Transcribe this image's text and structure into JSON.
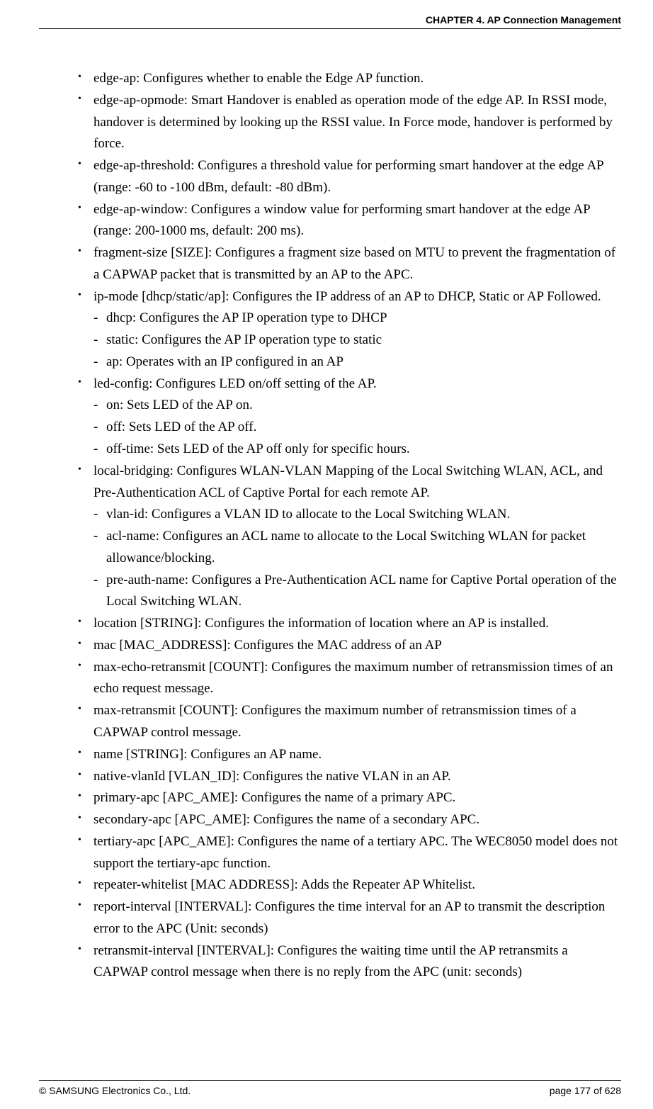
{
  "header": {
    "chapter": "CHAPTER 4. AP Connection Management"
  },
  "items": [
    {
      "text": "edge-ap: Configures whether to enable the Edge AP function."
    },
    {
      "text": "edge-ap-opmode: Smart Handover is enabled as operation mode of the edge AP. In RSSI mode, handover is determined by looking up the RSSI value. In Force mode, handover is performed by force."
    },
    {
      "text": "edge-ap-threshold: Configures a threshold value for performing smart handover at the edge AP (range: -60 to -100 dBm, default: -80 dBm)."
    },
    {
      "text": "edge-ap-window: Configures a window value for performing smart handover at the edge AP (range: 200-1000 ms, default: 200 ms)."
    },
    {
      "text": "fragment-size [SIZE]: Configures a fragment size based on MTU to prevent the fragmentation of a CAPWAP packet that is transmitted by an AP to the APC."
    },
    {
      "text": "ip-mode [dhcp/static/ap]: Configures the IP address of an AP to DHCP, Static or AP Followed.",
      "subs": [
        "dhcp: Configures the AP IP operation type to DHCP",
        "static: Configures the AP IP operation type to static",
        "ap: Operates with an IP configured in an AP"
      ]
    },
    {
      "text": "led-config: Configures LED on/off setting of the AP.",
      "subs": [
        "on: Sets LED of the AP on.",
        "off: Sets LED of the AP off.",
        "off-time: Sets LED of the AP off only for specific hours."
      ]
    },
    {
      "text": "local-bridging: Configures WLAN-VLAN Mapping of the Local Switching WLAN, ACL, and Pre-Authentication ACL of Captive Portal for each remote AP.",
      "subs": [
        "vlan-id: Configures a VLAN ID to allocate to the Local Switching WLAN.",
        "acl-name: Configures an ACL name to allocate to the Local Switching WLAN for packet allowance/blocking.",
        "pre-auth-name: Configures a Pre-Authentication ACL name for Captive Portal operation of the Local Switching WLAN."
      ]
    },
    {
      "text": "location [STRING]: Configures the information of location where an AP is installed."
    },
    {
      "text": "mac [MAC_ADDRESS]: Configures the MAC address of an AP"
    },
    {
      "text": "max-echo-retransmit [COUNT]: Configures the maximum number of retransmission times of an echo request message."
    },
    {
      "text": "max-retransmit [COUNT]: Configures the maximum number of retransmission times of a CAPWAP control message."
    },
    {
      "text": "name [STRING]: Configures an AP name."
    },
    {
      "text": "native-vlanId [VLAN_ID]: Configures the native VLAN in an AP."
    },
    {
      "text": "primary-apc [APC_AME]: Configures the name of a primary APC."
    },
    {
      "text": "secondary-apc [APC_AME]: Configures the name of a secondary APC."
    },
    {
      "text": "tertiary-apc [APC_AME]: Configures the name of a tertiary APC. The WEC8050 model does not support the tertiary-apc function."
    },
    {
      "text": "repeater-whitelist [MAC ADDRESS]: Adds the Repeater AP Whitelist."
    },
    {
      "text": "report-interval [INTERVAL]: Configures the time interval for an AP to transmit the description error to the APC (Unit: seconds)"
    },
    {
      "text": "retransmit-interval [INTERVAL]: Configures the waiting time until the AP retransmits a CAPWAP control message when there is no reply from the APC (unit: seconds)"
    }
  ],
  "footer": {
    "copyright": "© SAMSUNG Electronics Co., Ltd.",
    "page": "page 177 of 628"
  }
}
